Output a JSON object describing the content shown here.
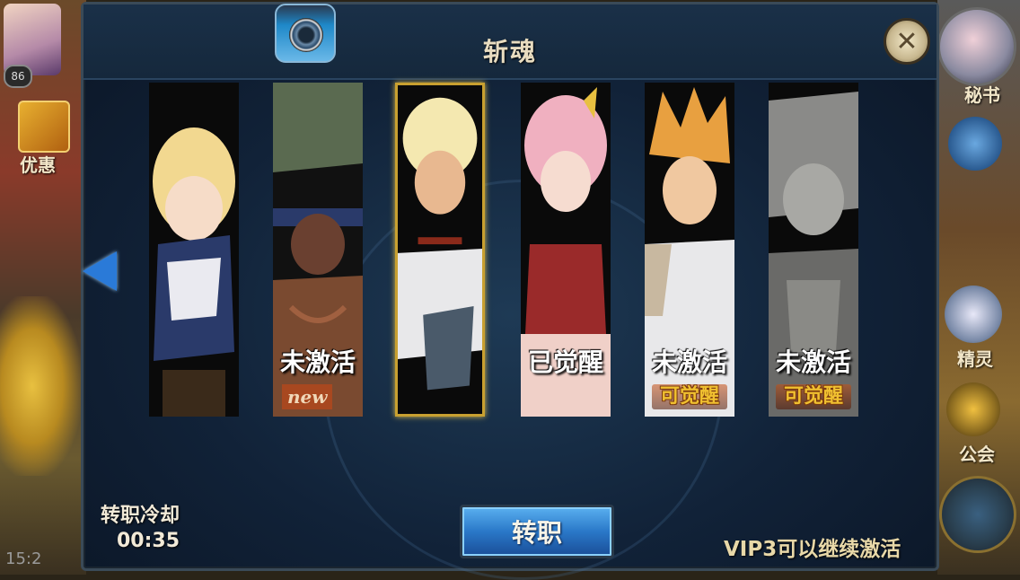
{
  "background": {
    "left_level": "86",
    "left_label": "优惠",
    "right_labels": [
      "秘书",
      "精灵",
      "公会"
    ],
    "clock": "15:2"
  },
  "dialog": {
    "title": "斩魂",
    "cooldown_label": "转职冷却",
    "cooldown_time": "00:35",
    "transfer_button": "转职",
    "vip_note": "VIP3可以继续激活"
  },
  "cards": [
    {
      "status": "",
      "badge": "",
      "selected": false
    },
    {
      "status": "未激活",
      "badge": "new",
      "badge_type": "new",
      "selected": false
    },
    {
      "status": "",
      "badge": "",
      "selected": true
    },
    {
      "status": "已觉醒",
      "badge": "",
      "selected": false
    },
    {
      "status": "未激活",
      "badge": "可觉醒",
      "badge_type": "awaken",
      "selected": false
    },
    {
      "status": "未激活",
      "badge": "可觉醒",
      "badge_type": "awaken",
      "selected": false
    }
  ],
  "colors": {
    "accent_button": "#2a78c8",
    "selected_border": "#c8a030",
    "title_text": "#e8dcc0"
  }
}
